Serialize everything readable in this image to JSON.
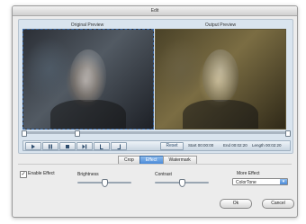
{
  "window": {
    "title": "Edit"
  },
  "preview": {
    "original_label": "Original Preview",
    "output_label": "Output Preview"
  },
  "controls": {
    "play_icon": "play-icon",
    "pause_icon": "pause-icon",
    "stop_icon": "stop-icon",
    "next_frame_icon": "next-frame-icon",
    "mark_in_icon": "mark-in-icon",
    "mark_out_icon": "mark-out-icon",
    "reset_label": "Reset",
    "start_label": "Start",
    "start_value": "00:00:00",
    "end_label": "End",
    "end_value": "00:02:20",
    "length_label": "Length",
    "length_value": "00:02:20"
  },
  "tabs": [
    {
      "label": "Crop",
      "active": false
    },
    {
      "label": "Effect",
      "active": true
    },
    {
      "label": "Watermark",
      "active": false
    }
  ],
  "effect": {
    "enable_label": "Enable Effect",
    "enable_checked": true,
    "brightness_label": "Brightness",
    "brightness_value": 0.5,
    "contrast_label": "Contrast",
    "contrast_value": 0.5,
    "more_effect_label": "More Effect",
    "more_effect_value": "ColorTone"
  },
  "footer": {
    "ok_label": "Ok",
    "cancel_label": "Cancel"
  },
  "colors": {
    "accent": "#4a8ad8",
    "panel": "#d9e4ee",
    "output_tint": "#8d7f55"
  }
}
